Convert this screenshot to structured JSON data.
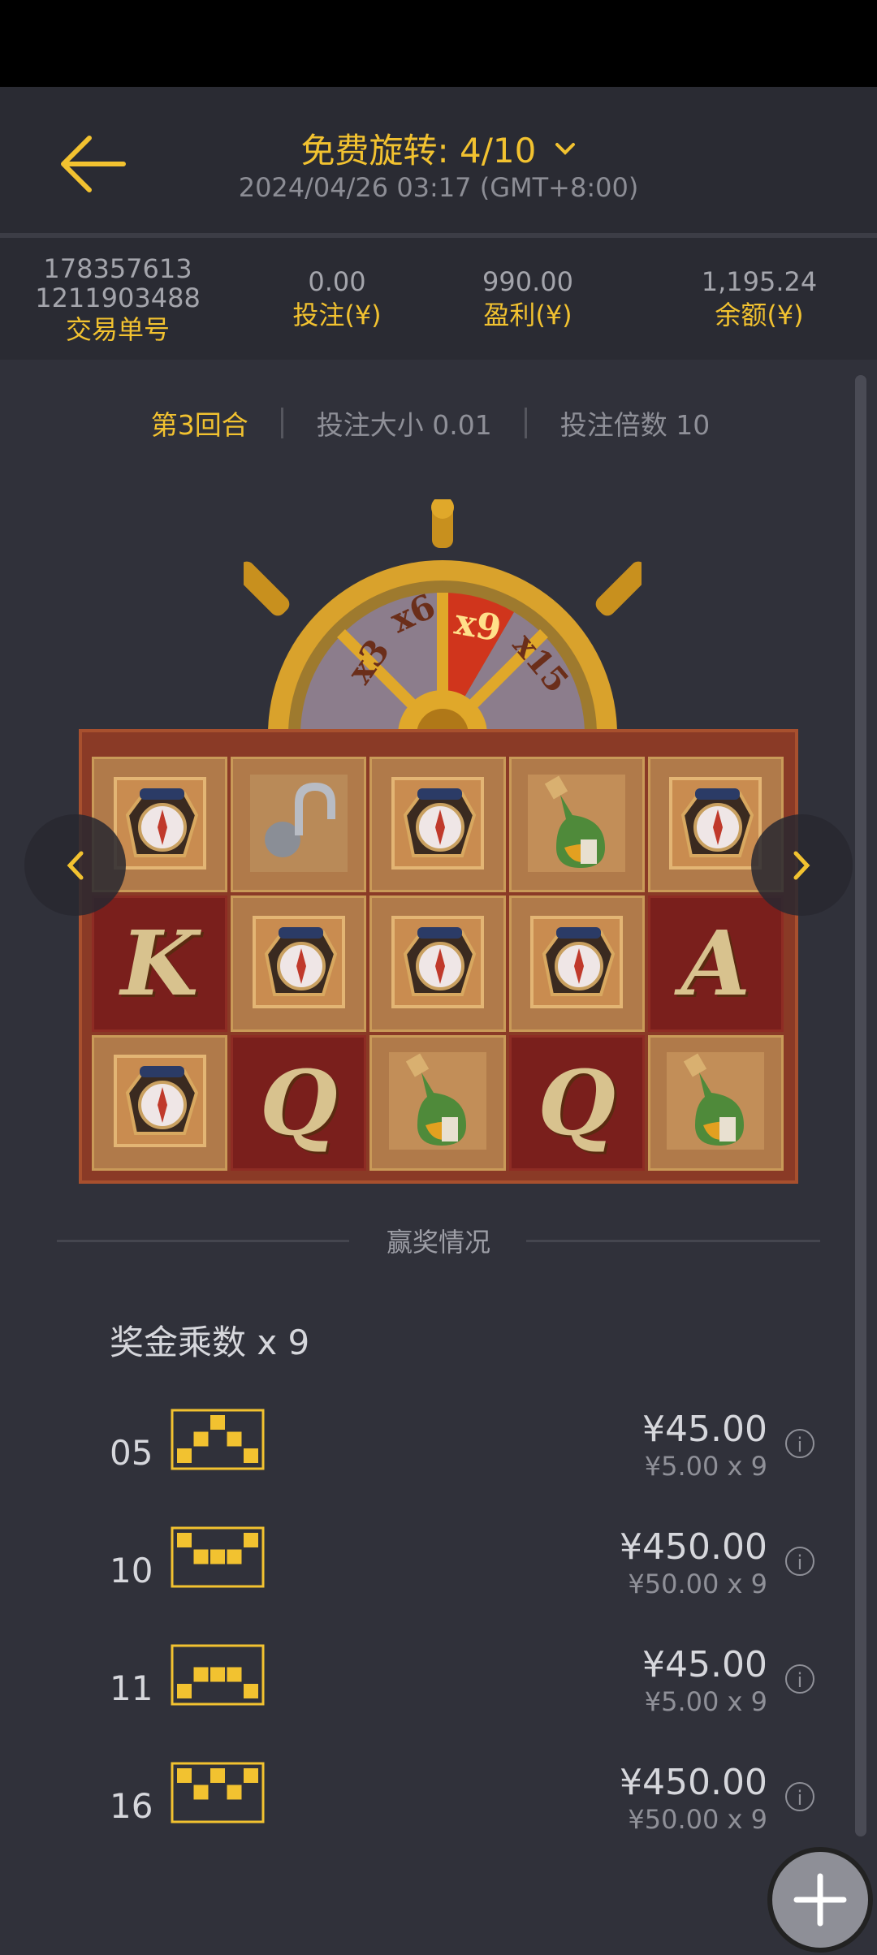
{
  "header": {
    "title": "免费旋转: 4/10",
    "datetime": "2024/04/26 03:17 (GMT+8:00)",
    "accent": "#f2c230"
  },
  "stats": {
    "order_no_line1": "178357613",
    "order_no_line2": "1211903488",
    "order_label": "交易单号",
    "bet_value": "0.00",
    "bet_label": "投注(¥)",
    "profit_value": "990.00",
    "profit_label": "盈利(¥)",
    "balance_value": "1,195.24",
    "balance_label": "余额(¥)"
  },
  "round": {
    "round_label": "第3回合",
    "bet_size": "投注大小 0.01",
    "bet_multiplier": "投注倍数 10"
  },
  "wheel": {
    "labels": [
      "x3",
      "x6",
      "x9",
      "x15"
    ],
    "highlighted": "x9"
  },
  "reels": {
    "rows": [
      [
        "compass-icon",
        "hook-icon",
        "compass-icon",
        "bottle-icon",
        "compass-icon"
      ],
      [
        "K",
        "compass-icon",
        "compass-icon",
        "compass-icon",
        "A"
      ],
      [
        "compass-icon",
        "Q",
        "bottle-icon",
        "Q",
        "bottle-icon"
      ]
    ]
  },
  "win": {
    "section_title": "赢奖情况",
    "multiplier": "奖金乘数 x 9",
    "lines": [
      {
        "num": "05",
        "amount": "¥45.00",
        "detail": "¥5.00 x 9",
        "info": "i"
      },
      {
        "num": "10",
        "amount": "¥450.00",
        "detail": "¥50.00 x 9",
        "info": "i"
      },
      {
        "num": "11",
        "amount": "¥45.00",
        "detail": "¥5.00 x 9",
        "info": "i"
      },
      {
        "num": "16",
        "amount": "¥450.00",
        "detail": "¥50.00 x 9",
        "info": "i"
      }
    ]
  }
}
